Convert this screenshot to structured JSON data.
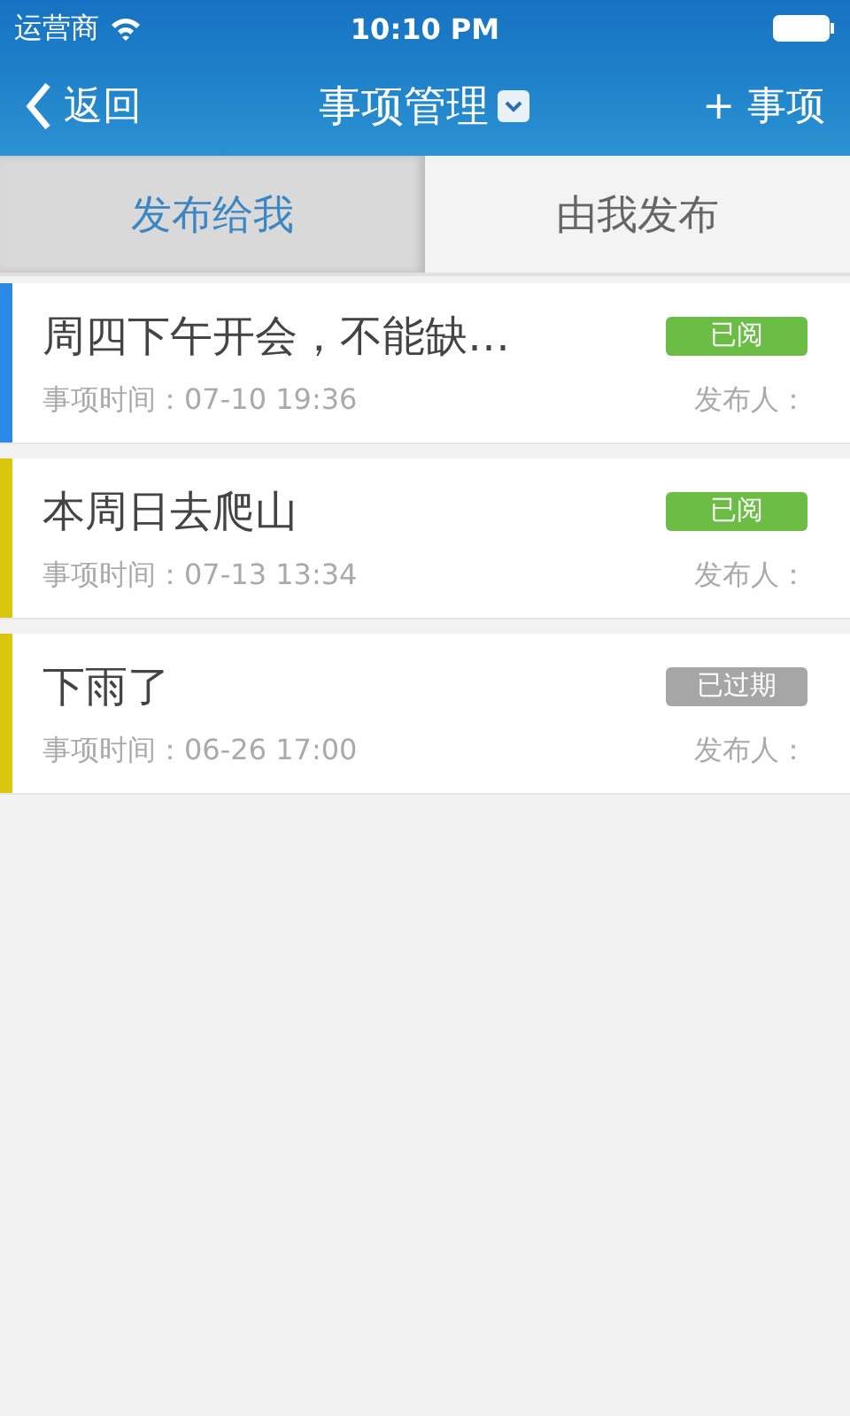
{
  "status_bar": {
    "carrier": "运营商",
    "time": "10:10 PM"
  },
  "nav": {
    "back": "返回",
    "title": "事项管理",
    "add": "+ 事项"
  },
  "tabs": [
    {
      "label": "发布给我",
      "selected": true
    },
    {
      "label": "由我发布",
      "selected": false
    }
  ],
  "items": [
    {
      "title": "周四下午开会，不能缺…",
      "time": "事项时间：07-10 19:36",
      "publisher": "发布人：",
      "badge": "已阅",
      "kind": "read",
      "color": "#2a8ae6"
    },
    {
      "title": "本周日去爬山",
      "time": "事项时间：07-13 13:34",
      "publisher": "发布人：",
      "badge": "已阅",
      "kind": "read",
      "color": "#d9c70d"
    },
    {
      "title": "下雨了",
      "time": "事项时间：06-26 17:00",
      "publisher": "发布人：",
      "badge": "已过期",
      "kind": "expired",
      "color": "#d9c70d"
    }
  ]
}
